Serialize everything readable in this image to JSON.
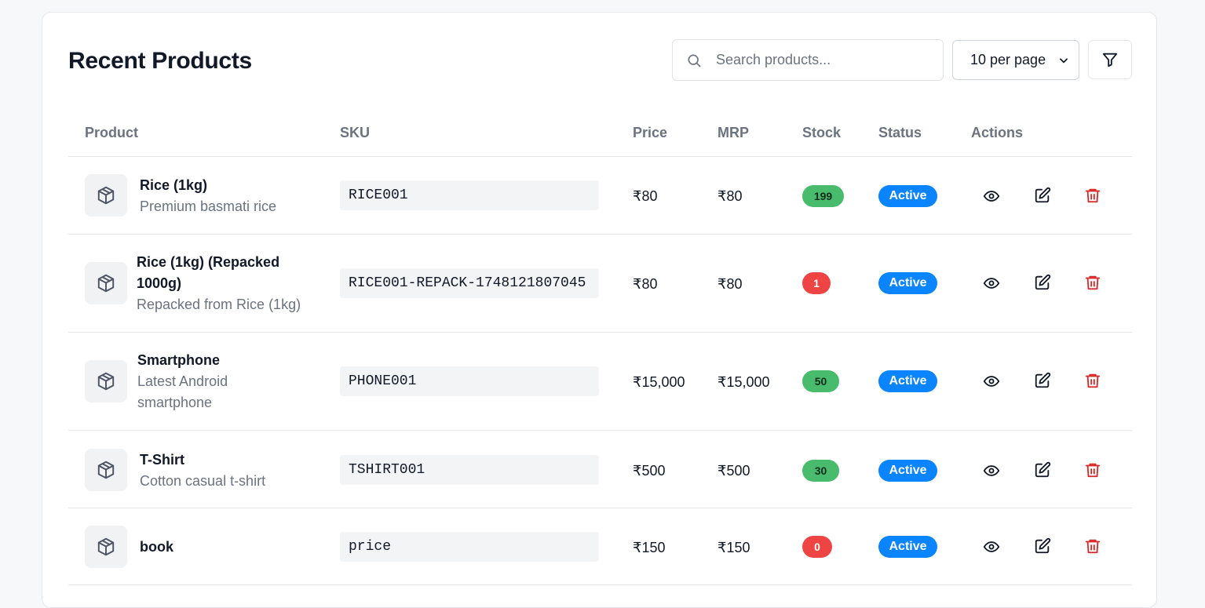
{
  "header": {
    "title": "Recent Products",
    "search_placeholder": "Search products...",
    "per_page": "10 per page",
    "per_page_options": [
      "10 per page"
    ]
  },
  "columns": [
    "Product",
    "SKU",
    "Price",
    "MRP",
    "Stock",
    "Status",
    "Actions"
  ],
  "icons": {
    "thumb": "package-icon",
    "view": "eye-icon",
    "edit": "edit-icon",
    "delete": "trash-icon",
    "search": "search-icon",
    "filter": "filter-icon",
    "select": "chevron-down-icon"
  },
  "colors": {
    "stock_ok": "#48bb6d",
    "stock_low": "#ef4444",
    "status_active": "#0b84ff",
    "delete": "#dc2626"
  },
  "rows": [
    {
      "name": "Rice (1kg)",
      "desc": "Premium basmati rice",
      "sku": "RICE001",
      "price": "₹80",
      "mrp": "₹80",
      "stock": "199",
      "stock_level": "ok",
      "status": "Active"
    },
    {
      "name": "Rice (1kg) (Repacked 1000g)",
      "desc": "Repacked from Rice (1kg)",
      "sku": "RICE001-REPACK-1748121807045",
      "price": "₹80",
      "mrp": "₹80",
      "stock": "1",
      "stock_level": "low",
      "status": "Active"
    },
    {
      "name": "Smartphone",
      "desc": "Latest Android smartphone",
      "sku": "PHONE001",
      "price": "₹15,000",
      "mrp": "₹15,000",
      "stock": "50",
      "stock_level": "ok",
      "status": "Active"
    },
    {
      "name": "T-Shirt",
      "desc": "Cotton casual t-shirt",
      "sku": "TSHIRT001",
      "price": "₹500",
      "mrp": "₹500",
      "stock": "30",
      "stock_level": "ok",
      "status": "Active"
    },
    {
      "name": "book",
      "desc": "",
      "sku": "price",
      "price": "₹150",
      "mrp": "₹150",
      "stock": "0",
      "stock_level": "low",
      "status": "Active"
    }
  ]
}
